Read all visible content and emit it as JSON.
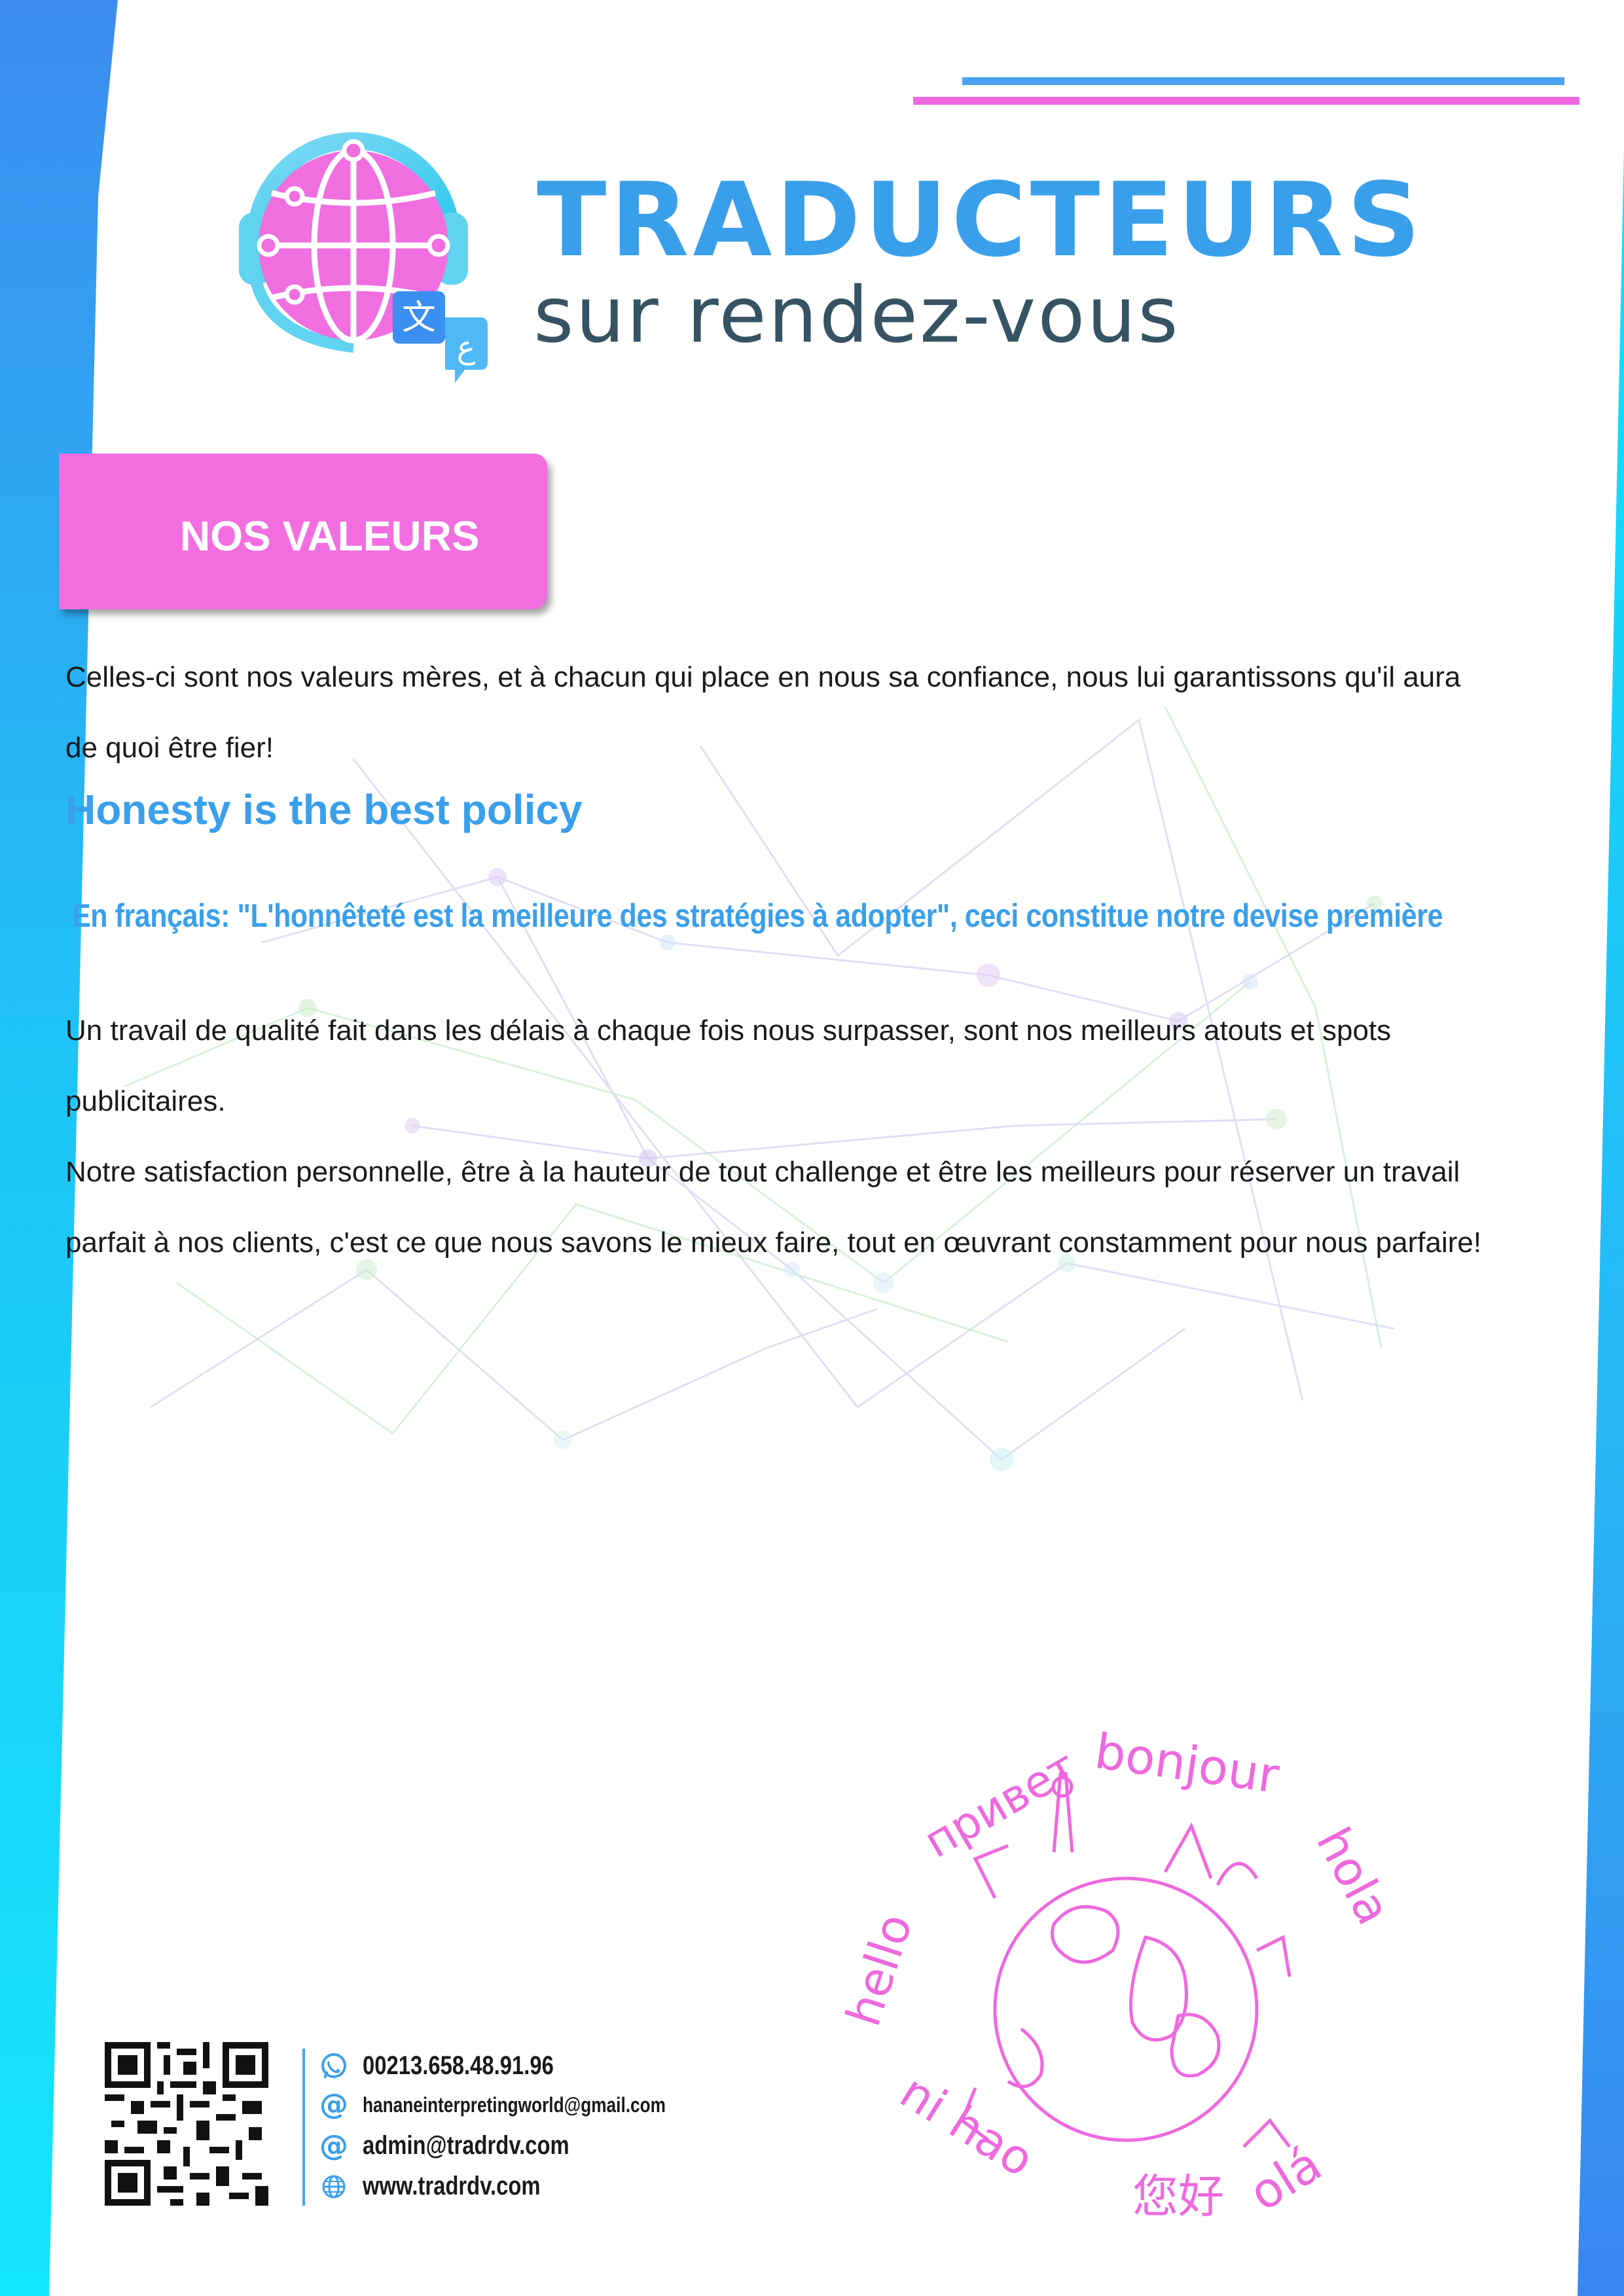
{
  "brand": {
    "title": "TRADUCTEURS",
    "subtitle": "sur rendez-vous",
    "badge_glyph_1": "文",
    "badge_glyph_2": "ع"
  },
  "section": {
    "title": "NOS VALEURS"
  },
  "intro": {
    "line1": "Celles-ci sont nos valeurs mères, et à chacun qui place en nous sa confiance, nous lui garantissons qu'il aura",
    "line2": "de quoi être fier!"
  },
  "motto": {
    "english": "Honesty is the best policy",
    "french": "En français: \"L'honnêteté est la meilleure des stratégies à adopter\", ceci constitue notre devise première"
  },
  "body": {
    "p1_line1": "Un travail de qualité fait dans les délais à chaque fois nous surpasser, sont nos meilleurs atouts et spots",
    "p1_line2": "publicitaires.",
    "p2_line1": "Notre satisfaction personnelle, être à la hauteur de tout challenge et être les meilleurs pour réserver un travail",
    "p2_line2": "parfait à nos clients, c'est ce que nous savons le mieux faire, tout en œuvrant constamment pour nous parfaire!"
  },
  "globe_words": {
    "hello": "hello",
    "privet": "привет",
    "bonjour": "bonjour",
    "hola": "hola",
    "nihao": "ni hao",
    "ninhao": "您好",
    "ola": "olá"
  },
  "contacts": {
    "phone": "00213.658.48.91.96",
    "email1": "hananeinterpretingworld@gmail.com",
    "email2": "admin@tradrdv.com",
    "website": "www.tradrdv.com"
  },
  "colors": {
    "accent_blue": "#3a9fea",
    "accent_pink": "#f26ee0",
    "cyan": "#16e4fa"
  }
}
